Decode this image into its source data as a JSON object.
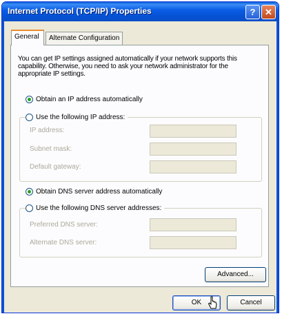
{
  "window": {
    "title": "Internet Protocol (TCP/IP) Properties",
    "help_label": "?",
    "close_label": "✕"
  },
  "tabs": [
    {
      "label": "General",
      "active": true
    },
    {
      "label": "Alternate Configuration",
      "active": false
    }
  ],
  "intro_text": "You can get IP settings assigned automatically if your network supports this capability. Otherwise, you need to ask your network administrator for the appropriate IP settings.",
  "ip_section": {
    "obtain_auto_label": "Obtain an IP address automatically",
    "obtain_auto_checked": true,
    "use_following_label": "Use the following IP address:",
    "use_following_checked": false,
    "fields": [
      {
        "label": "IP address:",
        "value": ""
      },
      {
        "label": "Subnet mask:",
        "value": ""
      },
      {
        "label": "Default gateway:",
        "value": ""
      }
    ]
  },
  "dns_section": {
    "obtain_auto_label": "Obtain DNS server address automatically",
    "obtain_auto_checked": true,
    "use_following_label": "Use the following DNS server addresses:",
    "use_following_checked": false,
    "fields": [
      {
        "label": "Preferred DNS server:",
        "value": ""
      },
      {
        "label": "Alternate DNS server:",
        "value": ""
      }
    ]
  },
  "buttons": {
    "advanced": "Advanced...",
    "ok": "OK",
    "cancel": "Cancel"
  },
  "colors": {
    "titlebar": "#0553d6",
    "dialog_bg": "#ece9d8",
    "radio_checked": "#21a121",
    "tab_highlight": "#e68b2c"
  },
  "icons": {
    "help": "help-icon",
    "close": "close-icon",
    "cursor": "mouse-pointer-icon"
  }
}
